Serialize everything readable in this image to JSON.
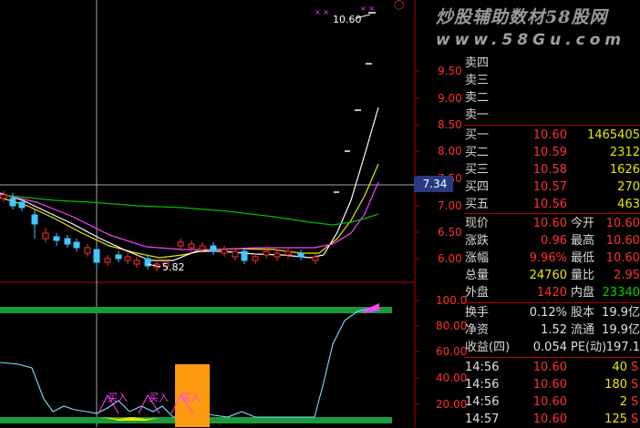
{
  "watermark": {
    "line1": "炒股辅助数材58股网",
    "line2": "www.58Gu.com"
  },
  "chart": {
    "price_axis": [
      "9.50",
      "9.00",
      "8.50",
      "8.00",
      "7.50",
      "7.00",
      "6.50",
      "6.00"
    ],
    "crosshair_value": "7.34",
    "high_label": "10.60",
    "low_label": "5.82",
    "indicator_axis": [
      "100.0",
      "80.00",
      "60.00",
      "40.00",
      "20.00"
    ],
    "signals": [
      "买入",
      "买入",
      "买入"
    ],
    "colors": {
      "axis": "#b00000",
      "candle_up": "#ff3030",
      "candle_down": "#40c8ff",
      "ma_white": "#ffffff",
      "ma_yellow": "#e8e800",
      "ma_magenta": "#ff40ff",
      "ma_green": "#00c000",
      "band": "#1a9a3a",
      "box": "#ff9a10"
    }
  },
  "order_book": {
    "sell": [
      {
        "label": "卖四",
        "price": "",
        "vol": ""
      },
      {
        "label": "卖三",
        "price": "",
        "vol": ""
      },
      {
        "label": "卖二",
        "price": "",
        "vol": ""
      },
      {
        "label": "卖一",
        "price": "",
        "vol": ""
      }
    ],
    "buy": [
      {
        "label": "买一",
        "price": "10.60",
        "vol": "1465405"
      },
      {
        "label": "买二",
        "price": "10.59",
        "vol": "2312"
      },
      {
        "label": "买三",
        "price": "10.58",
        "vol": "1626"
      },
      {
        "label": "买四",
        "price": "10.57",
        "vol": "270"
      },
      {
        "label": "买五",
        "price": "10.56",
        "vol": "463"
      }
    ]
  },
  "quote": [
    {
      "l1": "现价",
      "v1": "10.60",
      "l2": "今开",
      "v2": "10.60"
    },
    {
      "l1": "涨跌",
      "v1": "0.96",
      "l2": "最高",
      "v2": "10.60"
    },
    {
      "l1": "涨幅",
      "v1": "9.96%",
      "l2": "最低",
      "v2": "10.60"
    },
    {
      "l1": "总量",
      "v1": "24760",
      "l2": "量比",
      "v2": "2.95"
    },
    {
      "l1": "外盘",
      "v1": "1420",
      "l2": "内盘",
      "v2": "23340"
    }
  ],
  "fundamentals": [
    {
      "l1": "换手",
      "v1": "0.12%",
      "l2": "股本",
      "v2": "19.9亿"
    },
    {
      "l1": "净资",
      "v1": "1.52",
      "l2": "流通",
      "v2": "19.9亿"
    },
    {
      "l1": "收益(四)",
      "v1": "0.054",
      "l2": "PE(动)",
      "v2": "197.1"
    }
  ],
  "trades": [
    {
      "time": "14:56",
      "price": "10.60",
      "vol": "40",
      "flag": "S"
    },
    {
      "time": "14:56",
      "price": "10.60",
      "vol": "180",
      "flag": "S"
    },
    {
      "time": "14:56",
      "price": "10.60",
      "vol": "2",
      "flag": "S"
    },
    {
      "time": "14:57",
      "price": "10.60",
      "vol": "125",
      "flag": "S"
    }
  ]
}
